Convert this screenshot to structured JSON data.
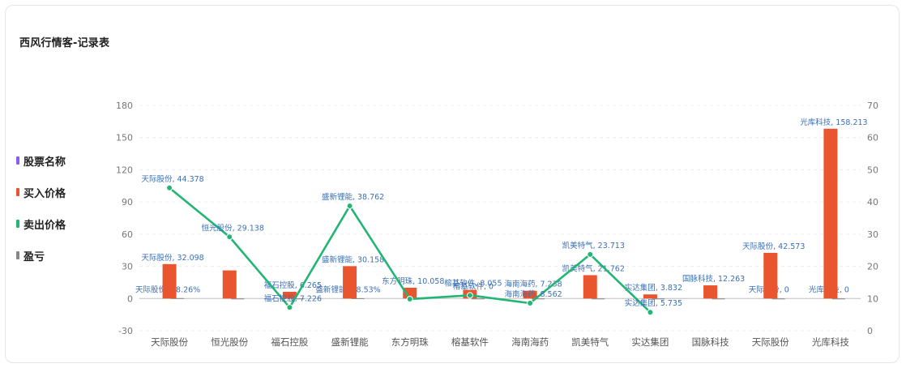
{
  "title": "西风行情客-记录表",
  "legend": [
    {
      "label": "股票名称",
      "color": "#8b5cf6"
    },
    {
      "label": "买入价格",
      "color": "#e8552e"
    },
    {
      "label": "卖出价格",
      "color": "#22b573"
    },
    {
      "label": "盈亏",
      "color": "#888888"
    }
  ],
  "chart_data": {
    "type": "bar",
    "categories": [
      "天际股份",
      "恒光股份",
      "福石控股",
      "盛新锂能",
      "东方明珠",
      "榕基软件",
      "海南海药",
      "凯美特气",
      "实达集团",
      "国脉科技",
      "天际股份",
      "光库科技"
    ],
    "left_axis": {
      "ylim": [
        -30,
        180
      ],
      "ticks": [
        -30,
        0,
        30,
        60,
        90,
        120,
        150,
        180
      ]
    },
    "right_axis": {
      "ylim": [
        0,
        70
      ],
      "ticks": [
        0,
        10,
        20,
        30,
        40,
        50,
        60,
        70
      ]
    },
    "grid": true,
    "series": [
      {
        "name": "买入价格",
        "kind": "bar",
        "axis": "left",
        "color": "#e8552e",
        "values": [
          32.098,
          26.2,
          6.265,
          30.158,
          10.058,
          8.055,
          7.238,
          21.762,
          3.832,
          12.263,
          42.573,
          158.213
        ],
        "labels": [
          "天际股份, 32.098",
          "",
          "福石控股, 6.265",
          "盛新锂能, 30.158",
          "东方明珠, 10.058",
          "榕基软件, 8.055",
          "海南海药, 7.238",
          "凯美特气, 21.762",
          "实达集团, 3.832",
          "国脉科技, 12.263",
          "天际股份, 42.573",
          "光库科技, 158.213"
        ]
      },
      {
        "name": "卖出价格",
        "kind": "line",
        "axis": "right",
        "color": "#22b573",
        "values": [
          44.378,
          29.138,
          7.226,
          38.762,
          9.83,
          11.0,
          8.562,
          23.713,
          5.735,
          null,
          null,
          null
        ],
        "labels": [
          "天际股份, 44.378",
          "恒光股份, 29.138",
          "福石控股, 7.226",
          "盛新锂能, 38.762",
          "",
          "榕基软件, 0",
          "海南海药, 8.562",
          "凯美特气, 23.713",
          "实达集团, 5.735",
          "",
          "",
          ""
        ]
      },
      {
        "name": "盈亏",
        "kind": "bar",
        "axis": "left",
        "color": "#888888",
        "values": [
          0.3826,
          0,
          0,
          0.2853,
          0,
          0,
          0,
          0,
          0,
          0,
          0,
          0
        ],
        "labels": [
          "天际股份, 38.26%",
          "",
          "",
          "盛新锂能, 28.53%",
          "",
          "",
          "",
          "",
          "",
          "",
          "天际股份, 0",
          "光库科技, 0"
        ]
      }
    ]
  }
}
